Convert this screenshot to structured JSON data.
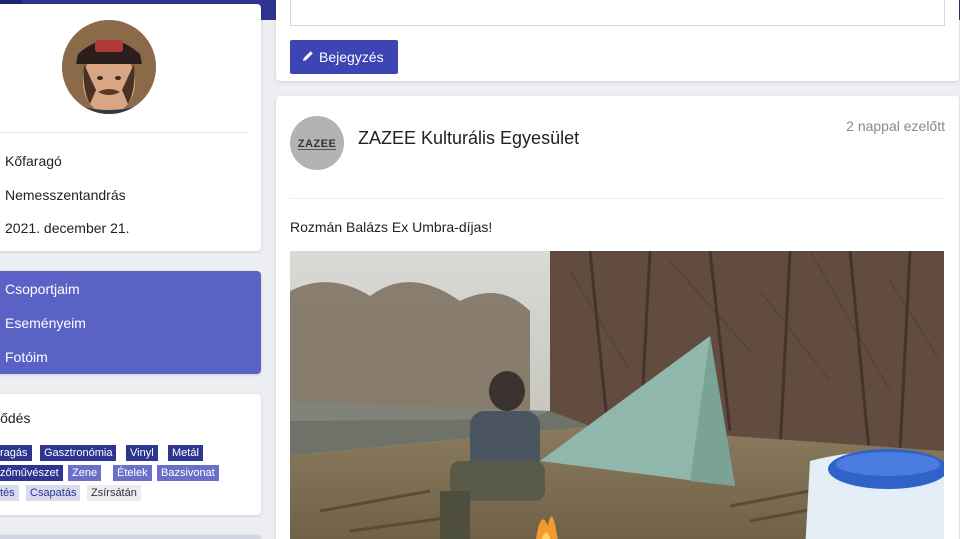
{
  "profile": {
    "occupation": "Kőfaragó",
    "location": "Nemesszentandrás",
    "joined": "2021. december 21."
  },
  "menu": {
    "items": [
      {
        "label": "Csoportjaim"
      },
      {
        "label": "Eseményeim"
      },
      {
        "label": "Fotóim"
      }
    ]
  },
  "interests": {
    "title": "klődés",
    "tags": [
      "ragás",
      "Gasztronómia",
      "Vinyl",
      "Metál",
      "zőművészet",
      "Zene",
      "Ételek",
      "Bazsivonat",
      "tés",
      "Csapatás",
      "Zsírsátán"
    ]
  },
  "composer": {
    "post_button_label": "Bejegyzés"
  },
  "post": {
    "author": "ZAZEE Kulturális Egyesület",
    "logo_text": "ZAZEE",
    "time": "2 nappal ezelőtt",
    "text": "Rozmán Balázs Ex Umbra-díjas!"
  },
  "colors": {
    "brand": "#2d3590",
    "menu": "#5b62c6",
    "button": "#3d44b3"
  }
}
